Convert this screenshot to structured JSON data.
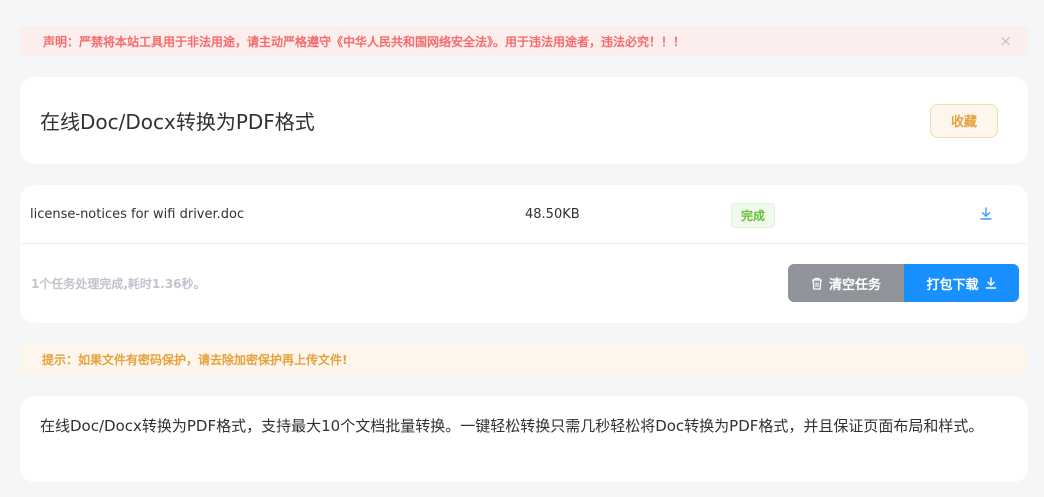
{
  "notice": {
    "text": "声明：严禁将本站工具用于非法用途，请主动严格遵守《中华人民共和国网络安全法》。用于违法用途者，违法必究！！！",
    "close": "×"
  },
  "header": {
    "title": "在线Doc/Docx转换为PDF格式",
    "favorite_label": "收藏"
  },
  "tasks": [
    {
      "filename": "license-notices for wifi driver.doc",
      "size": "48.50KB",
      "status": "完成"
    }
  ],
  "footer": {
    "summary": "1个任务处理完成,耗时1.36秒。",
    "clear_label": "清空任务",
    "pack_label": "打包下载"
  },
  "tip": {
    "text": "提示：如果文件有密码保护，请去除加密保护再上传文件!"
  },
  "description": {
    "text": "在线Doc/Docx转换为PDF格式，支持最大10个文档批量转换。一键轻松转换只需几秒轻松将Doc转换为PDF格式，并且保证页面布局和样式。"
  },
  "colors": {
    "error": "#f56c6c",
    "warning": "#e6a23c",
    "success": "#67c23a",
    "primary": "#1890ff",
    "info": "#909399"
  },
  "icons": {
    "close": "close-icon",
    "download": "download-icon",
    "trash": "trash-icon"
  }
}
